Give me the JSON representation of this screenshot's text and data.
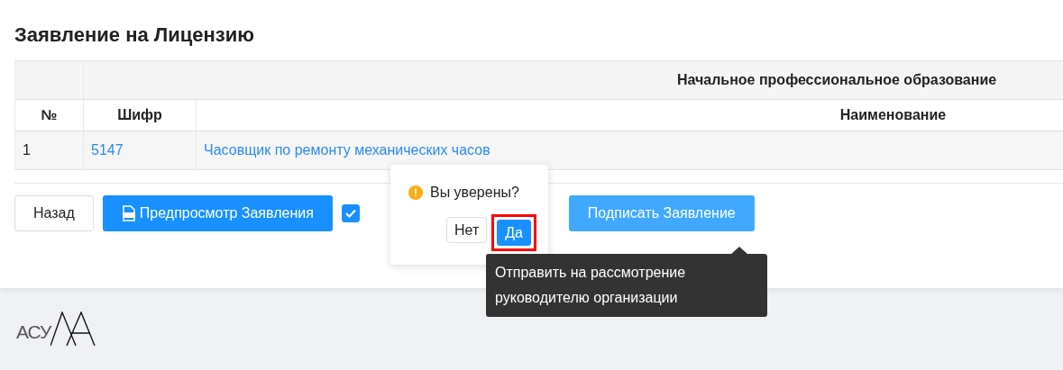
{
  "title": "Заявление на Лицензию",
  "table": {
    "group_header": "Начальное профессиональное образование",
    "columns": [
      "№",
      "Шифр",
      "Наименование"
    ],
    "rows": [
      {
        "number": "1",
        "code": "5147",
        "name": "Часовщик по ремонту механических часов"
      }
    ]
  },
  "actions": {
    "back": "Назад",
    "preview": "Предпросмотр Заявления",
    "agree_checkbox": {
      "checked": true
    },
    "sign": "Подписать Заявление"
  },
  "confirm_popover": {
    "message": "Вы уверены?",
    "cancel": "Нет",
    "ok": "Да",
    "ok_highlighted": true
  },
  "tooltip": "Отправить на рассмотрение руководителю организации",
  "footer": {
    "logo_text": "АСУ"
  }
}
